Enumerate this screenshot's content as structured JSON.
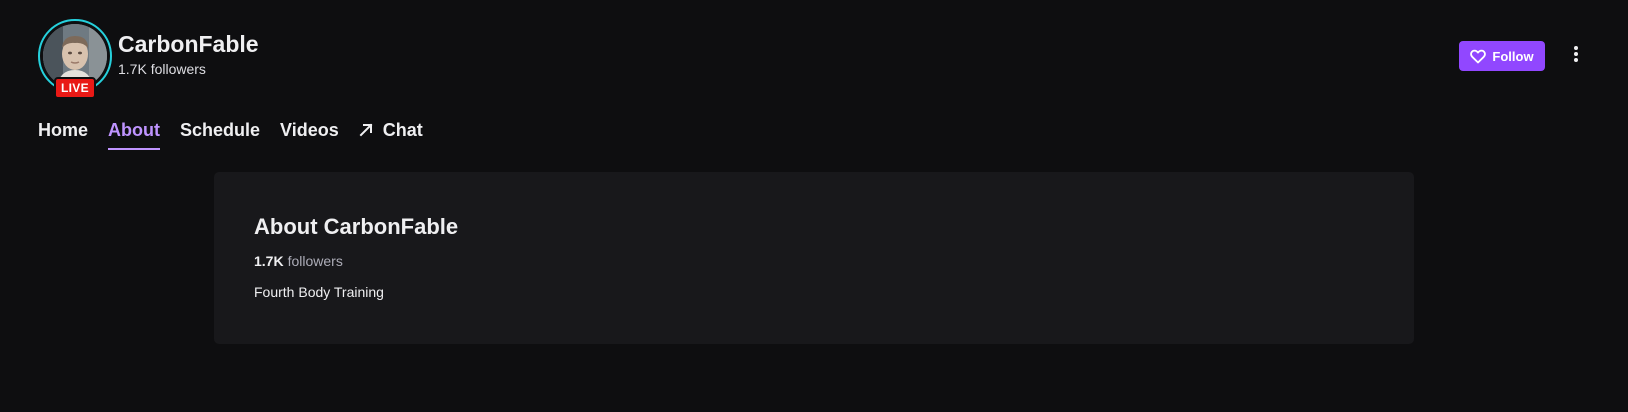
{
  "channel": {
    "name": "CarbonFable",
    "followers_text": "1.7K followers",
    "live_label": "LIVE",
    "ring_color": "#26d0dc",
    "live_color": "#e91916"
  },
  "actions": {
    "follow_label": "Follow",
    "follow_icon": "heart-icon",
    "more_icon": "vertical-ellipsis-icon",
    "accent_color": "#9147ff"
  },
  "tabs": [
    {
      "label": "Home",
      "active": false
    },
    {
      "label": "About",
      "active": true
    },
    {
      "label": "Schedule",
      "active": false
    },
    {
      "label": "Videos",
      "active": false
    },
    {
      "label": "Chat",
      "active": false,
      "icon": "external-arrow-icon"
    }
  ],
  "about": {
    "title": "About CarbonFable",
    "followers_count": "1.7K",
    "followers_label": "followers",
    "description": "Fourth Body Training"
  }
}
